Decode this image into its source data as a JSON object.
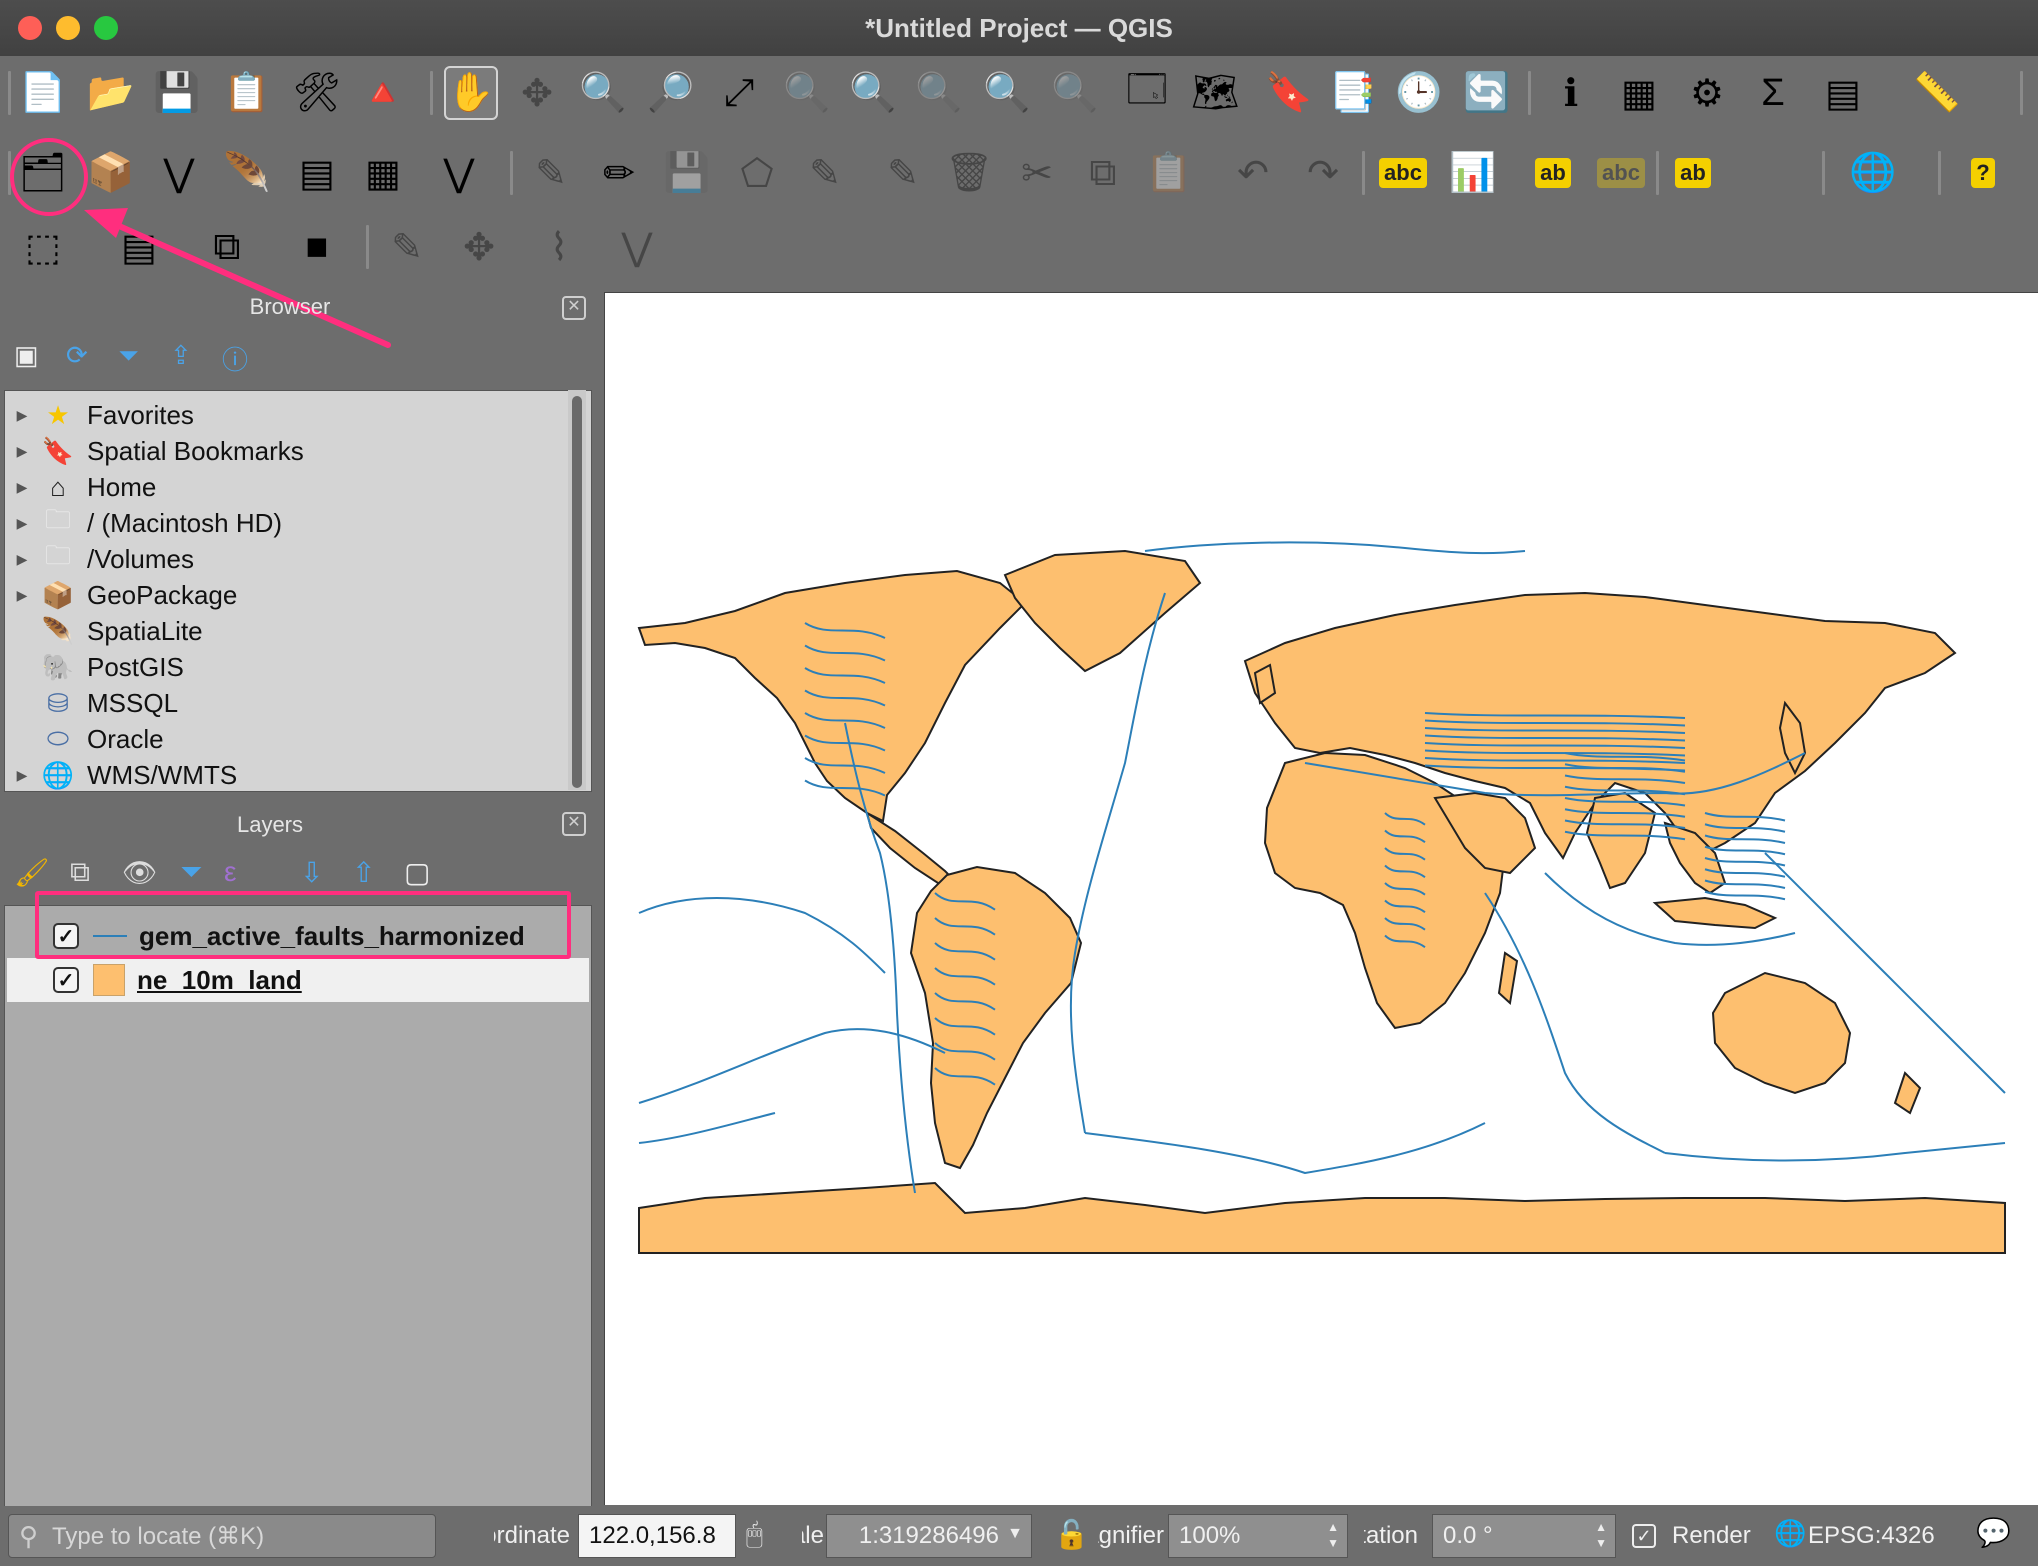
{
  "window": {
    "title": "*Untitled Project — QGIS"
  },
  "toolbar1": [
    {
      "name": "new-project-icon",
      "glyph": "📄"
    },
    {
      "name": "open-project-icon",
      "glyph": "📂"
    },
    {
      "name": "save-project-icon",
      "glyph": "💾"
    },
    {
      "name": "new-print-layout-icon",
      "glyph": "📋"
    },
    {
      "name": "style-manager-icon",
      "glyph": "🛠"
    },
    {
      "name": "label-toolbar-icon",
      "glyph": "🔺"
    },
    {
      "name": "pan-map-icon",
      "glyph": "✋"
    },
    {
      "name": "pan-to-selection-icon",
      "glyph": "✥"
    },
    {
      "name": "zoom-in-icon",
      "glyph": "🔍"
    },
    {
      "name": "zoom-out-icon",
      "glyph": "🔎"
    },
    {
      "name": "zoom-full-icon",
      "glyph": "⤢"
    },
    {
      "name": "zoom-to-selection-icon",
      "glyph": "🔍"
    },
    {
      "name": "zoom-to-layer-icon",
      "glyph": "🔍"
    },
    {
      "name": "zoom-native-icon",
      "glyph": "🔍"
    },
    {
      "name": "zoom-last-icon",
      "glyph": "🔍"
    },
    {
      "name": "zoom-next-icon",
      "glyph": "🔍"
    },
    {
      "name": "new-map-view-icon",
      "glyph": "🗔"
    },
    {
      "name": "new-3d-map-view-icon",
      "glyph": "🗺"
    },
    {
      "name": "new-spatial-bookmark-icon",
      "glyph": "🔖"
    },
    {
      "name": "show-bookmarks-icon",
      "glyph": "📑"
    },
    {
      "name": "temporal-controller-icon",
      "glyph": "🕒"
    },
    {
      "name": "refresh-icon",
      "glyph": "🔄"
    },
    {
      "name": "identify-features-icon",
      "glyph": "ℹ"
    },
    {
      "name": "attributes-toolbar-icon",
      "glyph": "▦"
    },
    {
      "name": "processing-toolbox-icon",
      "glyph": "⚙"
    },
    {
      "name": "statistical-summary-icon",
      "glyph": "Σ"
    },
    {
      "name": "open-attribute-table-icon",
      "glyph": "▤"
    },
    {
      "name": "measure-line-icon",
      "glyph": "📏"
    }
  ],
  "toolbar2": [
    {
      "name": "data-source-manager-icon",
      "glyph": "🗂"
    },
    {
      "name": "new-geopackage-layer-icon",
      "glyph": "📦"
    },
    {
      "name": "new-shapefile-layer-icon",
      "glyph": "⋁"
    },
    {
      "name": "new-spatialite-layer-icon",
      "glyph": "🪶"
    },
    {
      "name": "new-virtual-layer-icon",
      "glyph": "▤"
    },
    {
      "name": "new-mesh-layer-icon",
      "glyph": "▦"
    },
    {
      "name": "new-temporary-layer-icon",
      "glyph": "⋁"
    },
    {
      "name": "current-edits-icon",
      "glyph": "✎"
    },
    {
      "name": "toggle-editing-icon",
      "glyph": "✏"
    },
    {
      "name": "save-layer-edits-icon",
      "glyph": "💾"
    },
    {
      "name": "add-polygon-icon",
      "glyph": "⬠"
    },
    {
      "name": "vertex-tool-icon",
      "glyph": "✎"
    },
    {
      "name": "modify-attributes-icon",
      "glyph": "✎"
    },
    {
      "name": "delete-selected-icon",
      "glyph": "🗑"
    },
    {
      "name": "cut-features-icon",
      "glyph": "✂"
    },
    {
      "name": "copy-features-icon",
      "glyph": "⧉"
    },
    {
      "name": "paste-features-icon",
      "glyph": "📋"
    },
    {
      "name": "undo-icon",
      "glyph": "↶"
    },
    {
      "name": "redo-icon",
      "glyph": "↷"
    },
    {
      "name": "layer-labeling-icon",
      "glyph": "abc"
    },
    {
      "name": "layer-diagram-icon",
      "glyph": "📊"
    },
    {
      "name": "pin-labels-icon",
      "glyph": "ab"
    },
    {
      "name": "highlight-labels-icon",
      "glyph": "abc"
    },
    {
      "name": "move-label-icon",
      "glyph": "ab"
    },
    {
      "name": "metasearch-icon",
      "glyph": "🌐"
    },
    {
      "name": "help-icon",
      "glyph": "?"
    }
  ],
  "toolbar3": [
    {
      "name": "select-features-icon",
      "glyph": "⬚"
    },
    {
      "name": "select-by-value-icon",
      "glyph": "▤"
    },
    {
      "name": "deselect-features-icon",
      "glyph": "⧉"
    },
    {
      "name": "select-by-location-icon",
      "glyph": "■"
    },
    {
      "name": "digitize-icon",
      "glyph": "✎"
    },
    {
      "name": "advanced-digitize-icon",
      "glyph": "✥"
    },
    {
      "name": "shape-digitize-icon",
      "glyph": "⌇"
    },
    {
      "name": "reshape-icon",
      "glyph": "⋁"
    }
  ],
  "browser": {
    "title": "Browser",
    "items": [
      {
        "label": "Favorites",
        "icon": "star-icon",
        "glyph": "★",
        "color": "#f7c600",
        "arrow": true
      },
      {
        "label": "Spatial Bookmarks",
        "icon": "bookmark-icon",
        "glyph": "🔖",
        "color": "#888",
        "arrow": true
      },
      {
        "label": "Home",
        "icon": "home-icon",
        "glyph": "⌂",
        "color": "#222",
        "arrow": true
      },
      {
        "label": "/ (Macintosh HD)",
        "icon": "folder-icon",
        "glyph": "🗀",
        "color": "#eee",
        "arrow": true
      },
      {
        "label": "/Volumes",
        "icon": "folder-icon",
        "glyph": "🗀",
        "color": "#eee",
        "arrow": true
      },
      {
        "label": "GeoPackage",
        "icon": "geopackage-icon",
        "glyph": "📦",
        "color": "#e8c000",
        "arrow": true
      },
      {
        "label": "SpatiaLite",
        "icon": "spatialite-icon",
        "glyph": "🪶",
        "color": "#5a86c2",
        "arrow": false
      },
      {
        "label": "PostGIS",
        "icon": "postgis-icon",
        "glyph": "🐘",
        "color": "#4a6fa5",
        "arrow": false
      },
      {
        "label": "MSSQL",
        "icon": "mssql-icon",
        "glyph": "⛁",
        "color": "#4a6fa5",
        "arrow": false
      },
      {
        "label": "Oracle",
        "icon": "oracle-icon",
        "glyph": "⬭",
        "color": "#4a6fa5",
        "arrow": false
      },
      {
        "label": "WMS/WMTS",
        "icon": "wms-icon",
        "glyph": "🌐",
        "color": "#4a6fa5",
        "arrow": true
      }
    ]
  },
  "layers": {
    "title": "Layers",
    "items": [
      {
        "label": "gem_active_faults_harmonized",
        "checked": true,
        "symbol": "line",
        "color": "#2c7fb8"
      },
      {
        "label": "ne_10m_land",
        "checked": true,
        "symbol": "fill",
        "color": "#fdbf6f"
      }
    ]
  },
  "map": {
    "land_color": "#fdbf6f",
    "fault_color": "#2c7fb8"
  },
  "status": {
    "locator_placeholder": "Type to locate (⌘K)",
    "coord_label": "Coordinate",
    "coord_value": "122.0,156.8",
    "scale_label": "Scale",
    "scale_value": "1:319286496",
    "magnifier_label": "Magnifier",
    "magnifier_value": "100%",
    "rotation_label": "Rotation",
    "rotation_value": "0.0 °",
    "render_label": "Render",
    "crs_value": "EPSG:4326"
  }
}
